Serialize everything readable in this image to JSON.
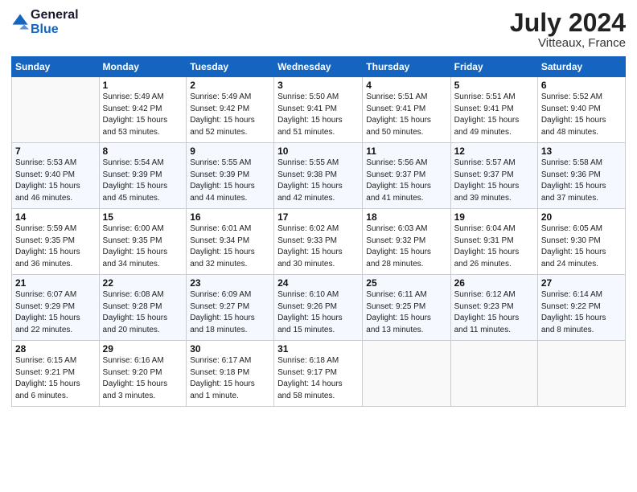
{
  "header": {
    "logo_line1": "General",
    "logo_line2": "Blue",
    "month_year": "July 2024",
    "location": "Vitteaux, France"
  },
  "weekdays": [
    "Sunday",
    "Monday",
    "Tuesday",
    "Wednesday",
    "Thursday",
    "Friday",
    "Saturday"
  ],
  "weeks": [
    [
      {
        "day": "",
        "info": ""
      },
      {
        "day": "1",
        "info": "Sunrise: 5:49 AM\nSunset: 9:42 PM\nDaylight: 15 hours\nand 53 minutes."
      },
      {
        "day": "2",
        "info": "Sunrise: 5:49 AM\nSunset: 9:42 PM\nDaylight: 15 hours\nand 52 minutes."
      },
      {
        "day": "3",
        "info": "Sunrise: 5:50 AM\nSunset: 9:41 PM\nDaylight: 15 hours\nand 51 minutes."
      },
      {
        "day": "4",
        "info": "Sunrise: 5:51 AM\nSunset: 9:41 PM\nDaylight: 15 hours\nand 50 minutes."
      },
      {
        "day": "5",
        "info": "Sunrise: 5:51 AM\nSunset: 9:41 PM\nDaylight: 15 hours\nand 49 minutes."
      },
      {
        "day": "6",
        "info": "Sunrise: 5:52 AM\nSunset: 9:40 PM\nDaylight: 15 hours\nand 48 minutes."
      }
    ],
    [
      {
        "day": "7",
        "info": "Sunrise: 5:53 AM\nSunset: 9:40 PM\nDaylight: 15 hours\nand 46 minutes."
      },
      {
        "day": "8",
        "info": "Sunrise: 5:54 AM\nSunset: 9:39 PM\nDaylight: 15 hours\nand 45 minutes."
      },
      {
        "day": "9",
        "info": "Sunrise: 5:55 AM\nSunset: 9:39 PM\nDaylight: 15 hours\nand 44 minutes."
      },
      {
        "day": "10",
        "info": "Sunrise: 5:55 AM\nSunset: 9:38 PM\nDaylight: 15 hours\nand 42 minutes."
      },
      {
        "day": "11",
        "info": "Sunrise: 5:56 AM\nSunset: 9:37 PM\nDaylight: 15 hours\nand 41 minutes."
      },
      {
        "day": "12",
        "info": "Sunrise: 5:57 AM\nSunset: 9:37 PM\nDaylight: 15 hours\nand 39 minutes."
      },
      {
        "day": "13",
        "info": "Sunrise: 5:58 AM\nSunset: 9:36 PM\nDaylight: 15 hours\nand 37 minutes."
      }
    ],
    [
      {
        "day": "14",
        "info": "Sunrise: 5:59 AM\nSunset: 9:35 PM\nDaylight: 15 hours\nand 36 minutes."
      },
      {
        "day": "15",
        "info": "Sunrise: 6:00 AM\nSunset: 9:35 PM\nDaylight: 15 hours\nand 34 minutes."
      },
      {
        "day": "16",
        "info": "Sunrise: 6:01 AM\nSunset: 9:34 PM\nDaylight: 15 hours\nand 32 minutes."
      },
      {
        "day": "17",
        "info": "Sunrise: 6:02 AM\nSunset: 9:33 PM\nDaylight: 15 hours\nand 30 minutes."
      },
      {
        "day": "18",
        "info": "Sunrise: 6:03 AM\nSunset: 9:32 PM\nDaylight: 15 hours\nand 28 minutes."
      },
      {
        "day": "19",
        "info": "Sunrise: 6:04 AM\nSunset: 9:31 PM\nDaylight: 15 hours\nand 26 minutes."
      },
      {
        "day": "20",
        "info": "Sunrise: 6:05 AM\nSunset: 9:30 PM\nDaylight: 15 hours\nand 24 minutes."
      }
    ],
    [
      {
        "day": "21",
        "info": "Sunrise: 6:07 AM\nSunset: 9:29 PM\nDaylight: 15 hours\nand 22 minutes."
      },
      {
        "day": "22",
        "info": "Sunrise: 6:08 AM\nSunset: 9:28 PM\nDaylight: 15 hours\nand 20 minutes."
      },
      {
        "day": "23",
        "info": "Sunrise: 6:09 AM\nSunset: 9:27 PM\nDaylight: 15 hours\nand 18 minutes."
      },
      {
        "day": "24",
        "info": "Sunrise: 6:10 AM\nSunset: 9:26 PM\nDaylight: 15 hours\nand 15 minutes."
      },
      {
        "day": "25",
        "info": "Sunrise: 6:11 AM\nSunset: 9:25 PM\nDaylight: 15 hours\nand 13 minutes."
      },
      {
        "day": "26",
        "info": "Sunrise: 6:12 AM\nSunset: 9:23 PM\nDaylight: 15 hours\nand 11 minutes."
      },
      {
        "day": "27",
        "info": "Sunrise: 6:14 AM\nSunset: 9:22 PM\nDaylight: 15 hours\nand 8 minutes."
      }
    ],
    [
      {
        "day": "28",
        "info": "Sunrise: 6:15 AM\nSunset: 9:21 PM\nDaylight: 15 hours\nand 6 minutes."
      },
      {
        "day": "29",
        "info": "Sunrise: 6:16 AM\nSunset: 9:20 PM\nDaylight: 15 hours\nand 3 minutes."
      },
      {
        "day": "30",
        "info": "Sunrise: 6:17 AM\nSunset: 9:18 PM\nDaylight: 15 hours\nand 1 minute."
      },
      {
        "day": "31",
        "info": "Sunrise: 6:18 AM\nSunset: 9:17 PM\nDaylight: 14 hours\nand 58 minutes."
      },
      {
        "day": "",
        "info": ""
      },
      {
        "day": "",
        "info": ""
      },
      {
        "day": "",
        "info": ""
      }
    ]
  ]
}
